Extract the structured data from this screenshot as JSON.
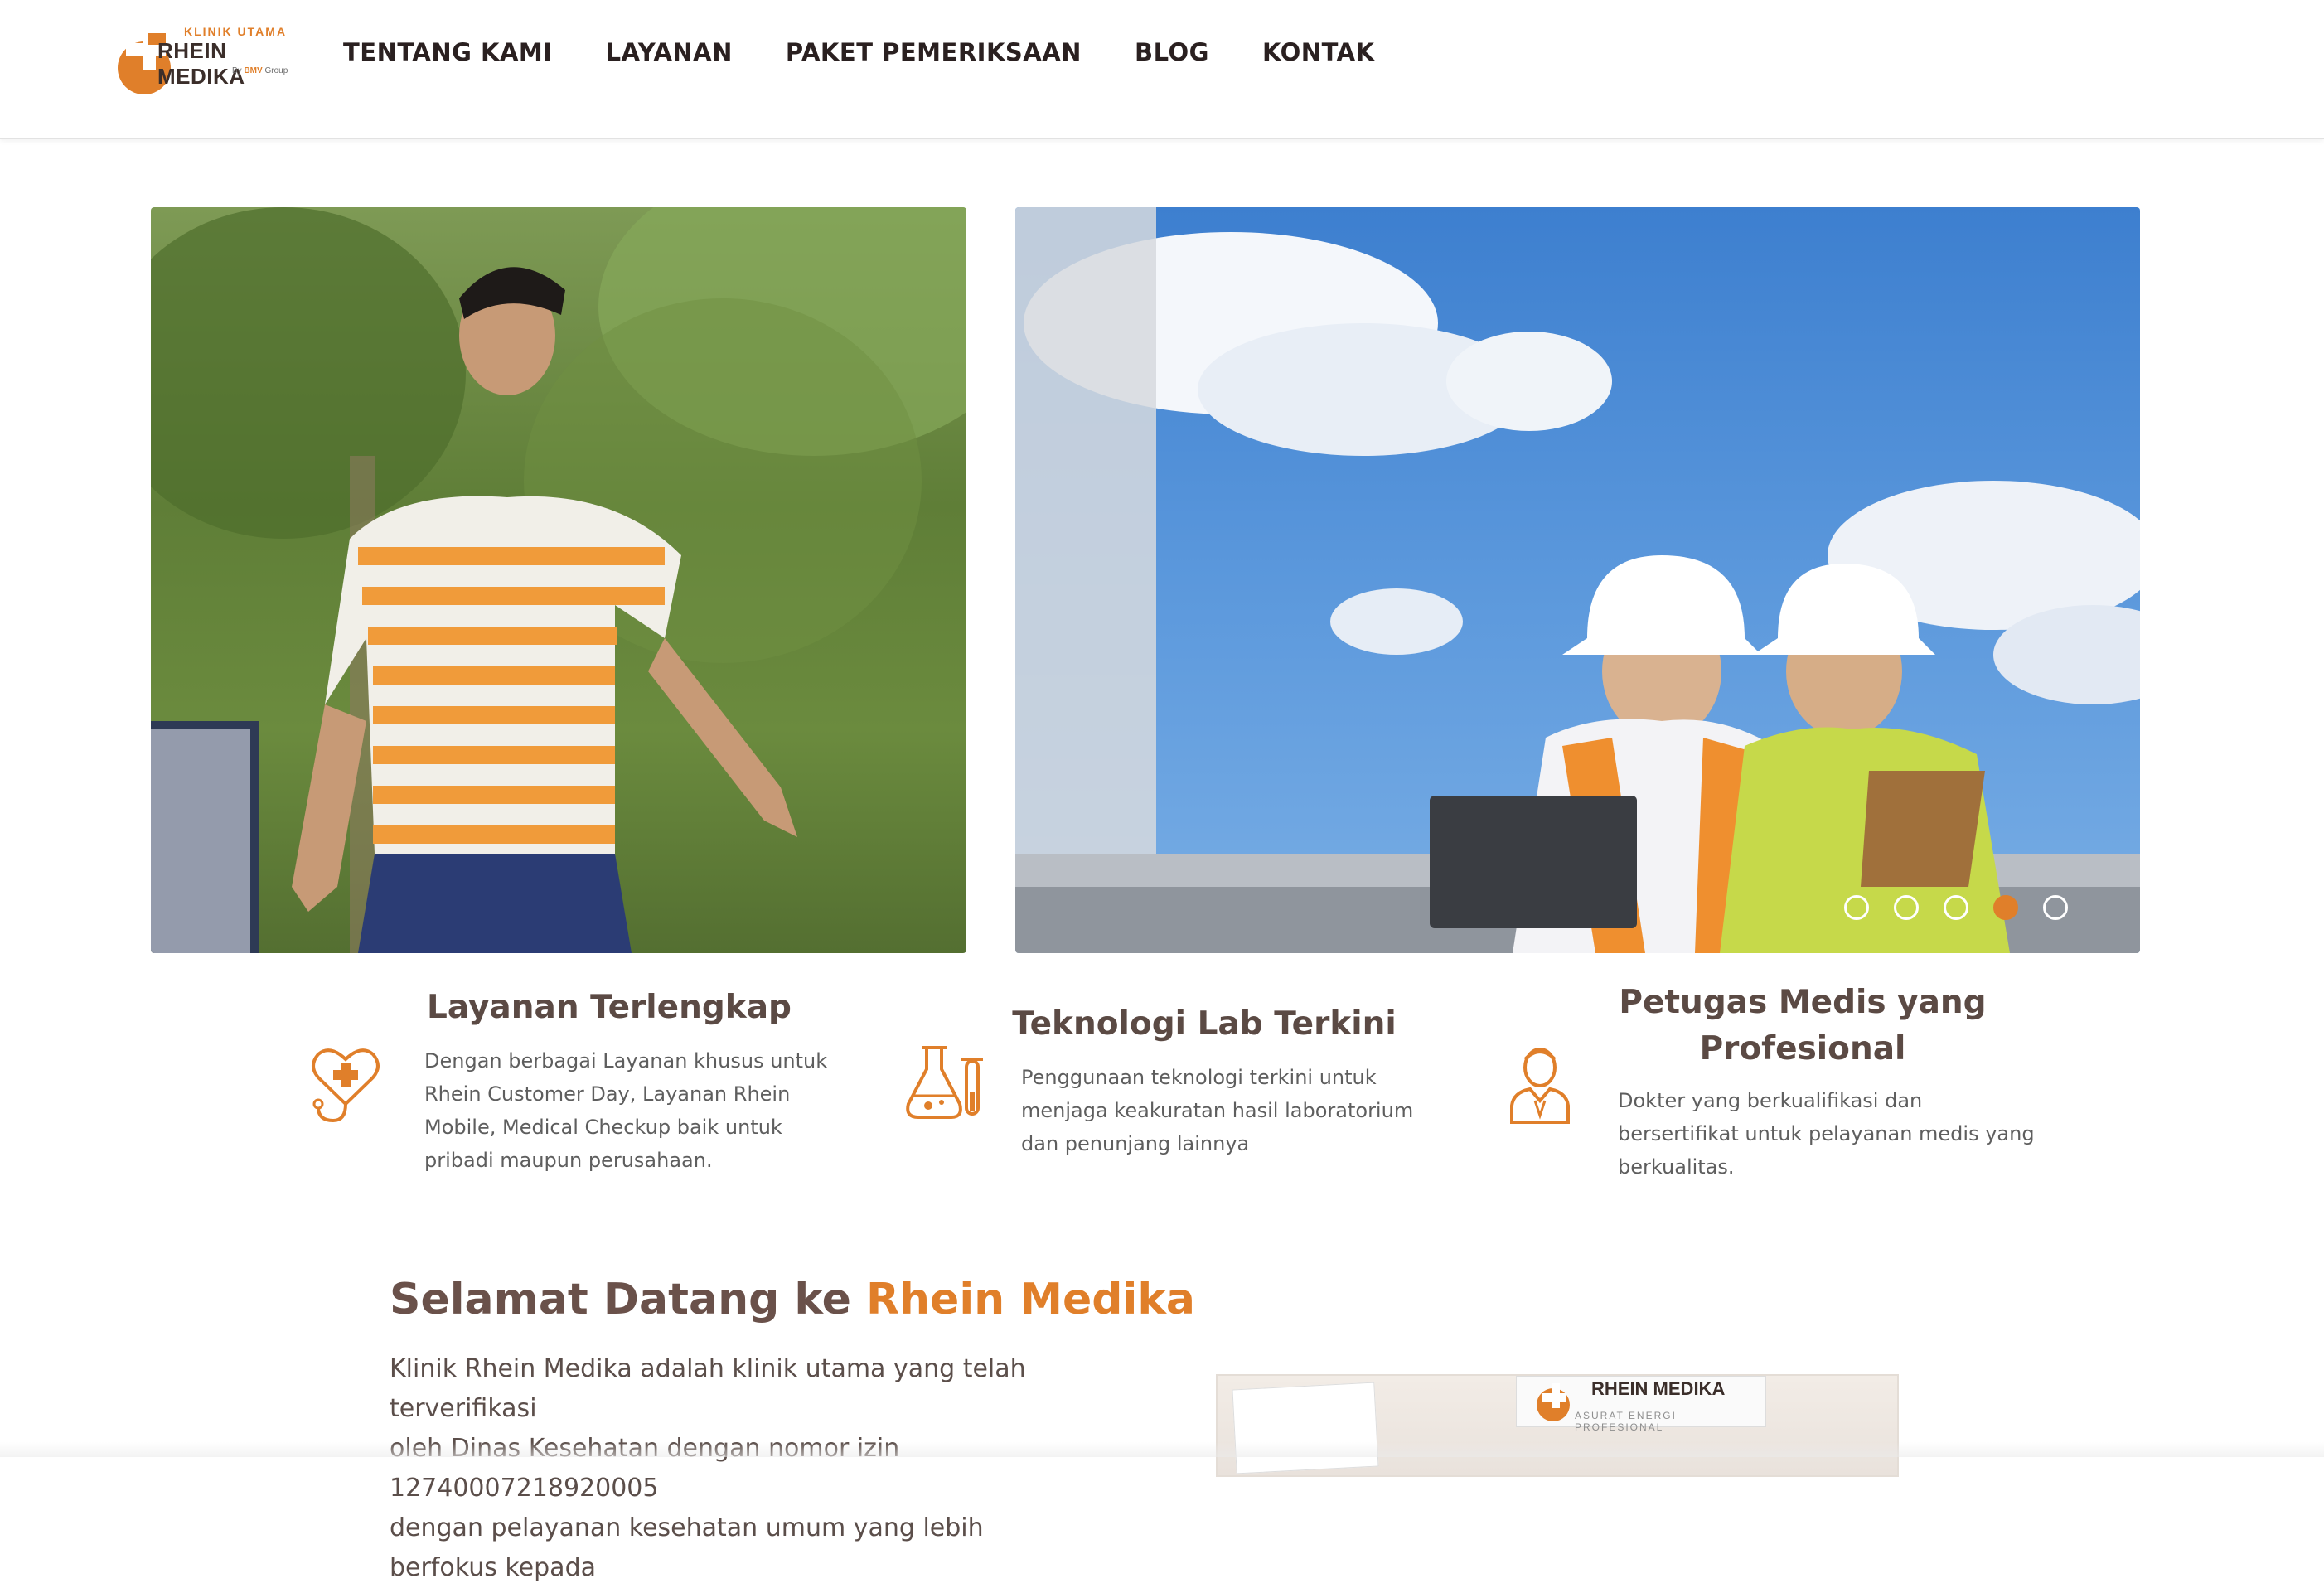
{
  "brand": {
    "small": "KLINIK UTAMA",
    "name": "RHEIN MEDIKA",
    "by_prefix": "By",
    "by_group": "BMV",
    "by_suffix": "Group"
  },
  "nav": [
    {
      "label": "TENTANG KAMI"
    },
    {
      "label": "LAYANAN"
    },
    {
      "label": "PAKET PEMERIKSAAN"
    },
    {
      "label": "BLOG"
    },
    {
      "label": "KONTAK"
    }
  ],
  "slider": {
    "slide_count": 5,
    "active_index": 4
  },
  "features": [
    {
      "title": "Layanan Terlengkap",
      "lines": [
        "Dengan berbagai Layanan khusus untuk",
        "Rhein Customer Day, Layanan Rhein",
        "Mobile, Medical Checkup baik untuk",
        "pribadi maupun perusahaan."
      ],
      "icon": "heart-stethoscope-icon"
    },
    {
      "title": "Teknologi Lab Terkini",
      "lines": [
        "Penggunaan teknologi terkini untuk",
        "menjaga keakuratan hasil laboratorium",
        "dan penunjang lainnya"
      ],
      "icon": "lab-flask-icon"
    },
    {
      "title_lines": [
        "Petugas Medis yang",
        "Profesional"
      ],
      "lines": [
        "Dokter yang berkualifikasi dan",
        "bersertifikat untuk pelayanan medis yang",
        "berkualitas."
      ],
      "icon": "doctor-icon"
    }
  ],
  "welcome": {
    "title_prefix": "Selamat Datang ke ",
    "title_accent": "Rhein Medika",
    "lines": [
      "Klinik Rhein Medika adalah klinik utama yang telah terverifikasi",
      "oleh Dinas Kesehatan dengan nomor izin 12740007218920005",
      "dengan pelayanan kesehatan umum yang lebih berfokus kepada"
    ],
    "photo_banner": "RHEIN MEDIKA",
    "photo_banner_sub": "ASURAT ENERGI PROFESIONAL"
  },
  "colors": {
    "accent": "#e07f2a",
    "heading": "#5b4a44",
    "text": "#5e5e5e"
  }
}
